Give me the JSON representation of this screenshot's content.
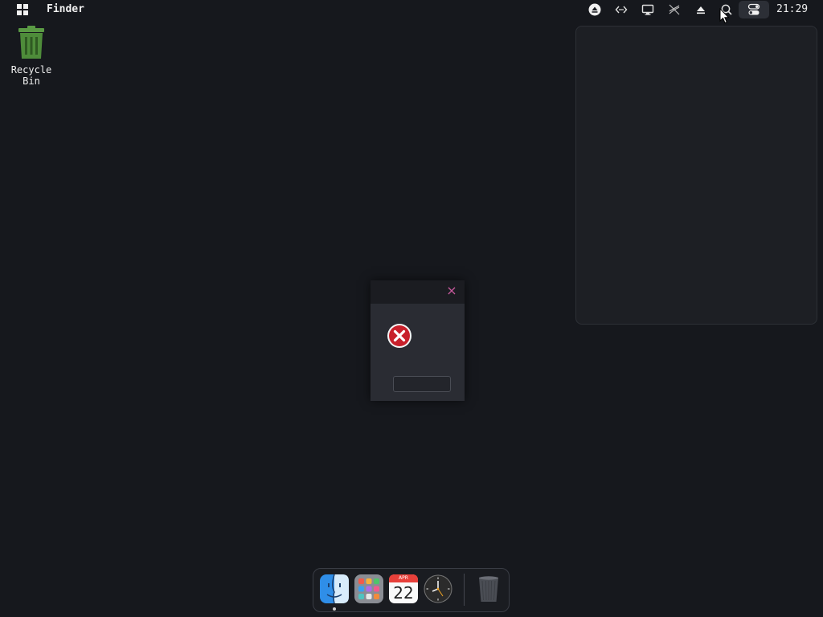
{
  "menubar": {
    "app_name": "Finder",
    "clock": "21:29",
    "tray": [
      "eject-circle-icon",
      "network-arrows-icon",
      "display-icon",
      "sound-muted-icon",
      "eject-icon",
      "search-icon",
      "control-center-icon"
    ]
  },
  "desktop": {
    "icons": [
      {
        "label": "Recycle Bin",
        "icon": "trash-icon"
      }
    ]
  },
  "dialog": {
    "icon": "error-icon",
    "close_glyph": "×",
    "ok_label": ""
  },
  "dock": {
    "items": [
      {
        "name": "finder",
        "icon": "finder-icon"
      },
      {
        "name": "launchpad",
        "icon": "launchpad-icon"
      },
      {
        "name": "calendar",
        "icon": "calendar-icon",
        "month": "APR",
        "day": "22"
      },
      {
        "name": "clock",
        "icon": "clock-icon"
      },
      {
        "name": "trash",
        "icon": "trash-icon"
      }
    ]
  },
  "colors": {
    "desktop_bg": "#16181d",
    "panel_bg": "#1d1f24",
    "accent_close": "#c85a9d",
    "error_red": "#c8202b",
    "recycle_green": "#4e8c3a"
  }
}
